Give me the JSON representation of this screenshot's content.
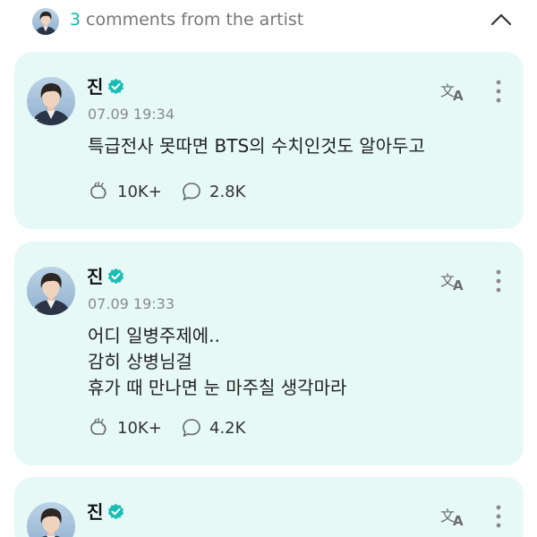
{
  "header": {
    "count": "3",
    "title": "comments from the artist",
    "collapse_icon": "chevron-up-icon"
  },
  "colors": {
    "accent": "#12b5b0",
    "card_bg": "#e6f9f6",
    "time": "#8a8a8a"
  },
  "comments": [
    {
      "author": "진",
      "verified_icon": "verified-badge-icon",
      "time": "07.09 19:34",
      "lines": [
        "특급전사 못따면 BTS의 수치인것도 알아두고"
      ],
      "likes": "10K+",
      "replies": "2.8K"
    },
    {
      "author": "진",
      "verified_icon": "verified-badge-icon",
      "time": "07.09 19:33",
      "lines": [
        "어디 일병주제에..",
        "감히 상병님걸",
        "휴가 때 만나면 눈 마주칠 생각마라"
      ],
      "likes": "10K+",
      "replies": "4.2K"
    },
    {
      "author": "진",
      "verified_icon": "verified-badge-icon"
    }
  ]
}
